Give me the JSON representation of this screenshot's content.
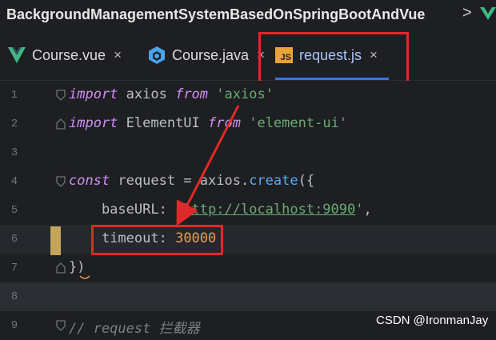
{
  "titlebar": {
    "project_name": "BackgroundManagementSystemBasedOnSpringBootAndVue",
    "chevron": ">"
  },
  "tabs": [
    {
      "label": "Course.vue",
      "icon": "vue-icon",
      "close": "×",
      "active": false
    },
    {
      "label": "Course.java",
      "icon": "java-icon",
      "close": "×",
      "active": false
    },
    {
      "label": "request.js",
      "icon": "js-icon",
      "icon_text": "JS",
      "close": "×",
      "active": true
    }
  ],
  "editor": {
    "lines": [
      {
        "number": "1",
        "parts": [
          [
            "kw",
            "import"
          ],
          [
            "plain",
            " axios "
          ],
          [
            "kw",
            "from"
          ],
          [
            "plain",
            " "
          ],
          [
            "str",
            "'axios'"
          ]
        ]
      },
      {
        "number": "2",
        "parts": [
          [
            "kw",
            "import"
          ],
          [
            "plain",
            " ElementUI "
          ],
          [
            "kw",
            "from"
          ],
          [
            "plain",
            " "
          ],
          [
            "str",
            "'element-ui'"
          ]
        ]
      },
      {
        "number": "3",
        "parts": []
      },
      {
        "number": "4",
        "parts": [
          [
            "kw",
            "const"
          ],
          [
            "plain",
            " request = axios."
          ],
          [
            "fn",
            "create"
          ],
          [
            "plain",
            "({"
          ]
        ]
      },
      {
        "number": "5",
        "parts": [
          [
            "plain",
            "    baseURL: "
          ],
          [
            "str",
            "'"
          ],
          [
            "url",
            "http://localhost:9090"
          ],
          [
            "str",
            "'"
          ],
          [
            "plain",
            ","
          ]
        ]
      },
      {
        "number": "6",
        "parts": [
          [
            "plain",
            "    "
          ],
          [
            "plain",
            "timeout: "
          ],
          [
            "num",
            "30000"
          ]
        ]
      },
      {
        "number": "7",
        "parts": [
          [
            "plain",
            "})"
          ]
        ]
      },
      {
        "number": "8",
        "parts": []
      },
      {
        "number": "9",
        "parts": [
          [
            "cm",
            "// request 拦截器"
          ]
        ]
      }
    ]
  },
  "watermark": "CSDN @IronmanJay",
  "colors": {
    "highlight_border": "#e0292a",
    "keyword": "#cf8ef4",
    "string": "#6aab73",
    "number": "#e6a05a"
  }
}
